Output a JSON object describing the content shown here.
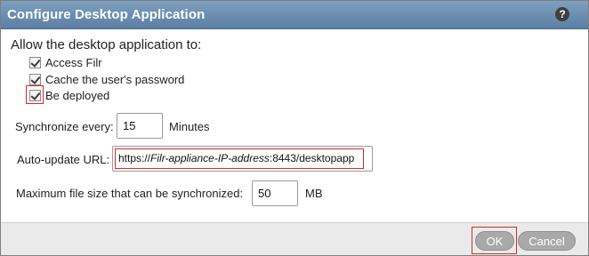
{
  "dialog": {
    "title": "Configure Desktop Application",
    "help_icon": "help-icon"
  },
  "heading": "Allow the desktop application to:",
  "options": [
    {
      "label": "Access Filr",
      "checked": true
    },
    {
      "label": "Cache the user's password",
      "checked": true
    },
    {
      "label": "Be deployed",
      "checked": true
    }
  ],
  "sync": {
    "label": "Synchronize every:",
    "value": "15",
    "unit": "Minutes"
  },
  "auto_update": {
    "label": "Auto-update URL:",
    "prefix": "https://",
    "host": "Filr-appliance-IP-address",
    "suffix": ":8443/desktopapp"
  },
  "max_size": {
    "label": "Maximum file size that can be synchronized:",
    "value": "50",
    "unit": "MB"
  },
  "buttons": {
    "ok": "OK",
    "cancel": "Cancel"
  },
  "colors": {
    "titlebar": "#6a8db0",
    "highlight": "#d12b2b",
    "button": "#a9a9a9"
  }
}
